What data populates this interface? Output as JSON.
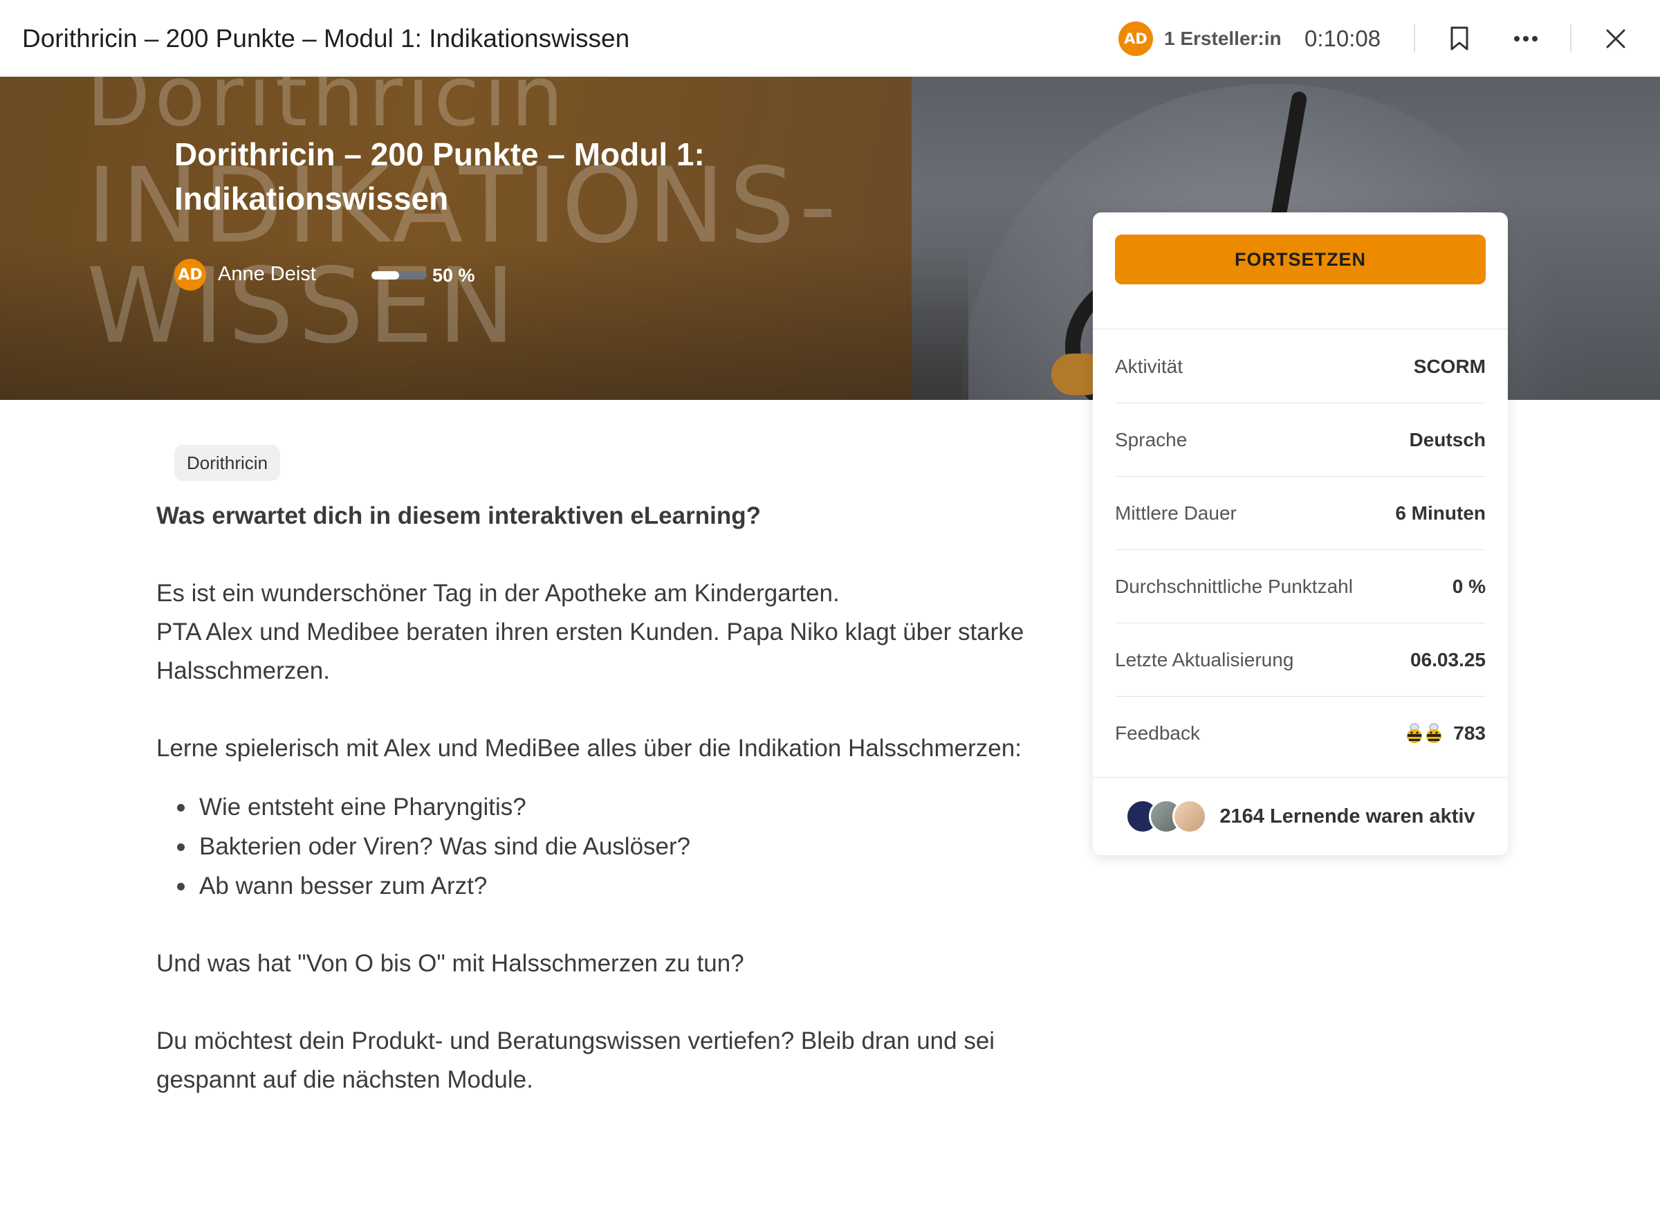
{
  "topbar": {
    "title": "Dorithricin – 200 Punkte – Modul 1: Indikationswissen",
    "creator_initials": "AD",
    "creators": "1 Ersteller:in",
    "timer": "0:10:08"
  },
  "hero": {
    "title": "Dorithricin – 200 Punkte – Modul 1: Indikationswissen",
    "author_initials": "AD",
    "author": "Anne Deist",
    "progress_label": "50 %",
    "progress_fraction": 0.5,
    "bg_words": [
      "Dorithricin",
      "INDIKATIONS-",
      "WISSEN"
    ]
  },
  "tag": "Dorithricin",
  "content": {
    "heading": "Was erwartet dich in diesem interaktiven eLearning?",
    "p1_line1": "Es ist ein wunderschöner Tag in der Apotheke am Kindergarten.",
    "p1_line2": "PTA Alex und Medibee beraten ihren ersten Kunden. Papa Niko klagt über starke Halsschmerzen.",
    "p2": "Lerne spielerisch mit Alex und MediBee alles über die Indikation Halsschmerzen:",
    "bullets": [
      "Wie entsteht eine Pharyngitis?",
      "Bakterien oder Viren? Was sind die Auslöser?",
      "Ab wann besser zum Arzt?"
    ],
    "p3": "Und was hat \"Von O bis O\" mit Halsschmerzen zu tun?",
    "p4": "Du möchtest dein Produkt- und Beratungswissen vertiefen? Bleib dran und sei gespannt auf die nächsten Module."
  },
  "card": {
    "cta": "FORTSETZEN",
    "rows": [
      {
        "key": "Aktivität",
        "value": "SCORM"
      },
      {
        "key": "Sprache",
        "value": "Deutsch"
      },
      {
        "key": "Mittlere Dauer",
        "value": "6 Minuten"
      },
      {
        "key": "Durchschnittliche Punktzahl",
        "value": "0 %"
      },
      {
        "key": "Letzte Aktualisierung",
        "value": "06.03.25"
      },
      {
        "key": "Feedback",
        "value": "783"
      }
    ],
    "learners": "2164 Lernende waren aktiv"
  },
  "colors": {
    "accent": "#ec8b00",
    "avatar": "#ef8a00"
  },
  "icons": {
    "bookmark": "bookmark-icon",
    "more": "more-icon",
    "close": "close-icon",
    "feedback": "bee-icon"
  }
}
